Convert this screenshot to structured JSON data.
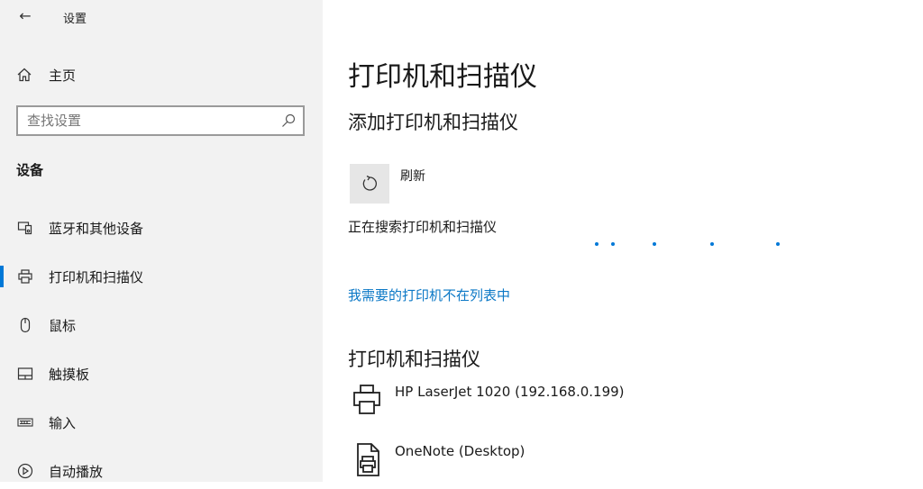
{
  "app": {
    "title": "设置"
  },
  "sidebar": {
    "home_label": "主页",
    "search_placeholder": "查找设置",
    "section": "设备",
    "items": [
      {
        "label": "蓝牙和其他设备",
        "icon": "bluetooth-devices-icon",
        "active": false
      },
      {
        "label": "打印机和扫描仪",
        "icon": "printer-icon",
        "active": true
      },
      {
        "label": "鼠标",
        "icon": "mouse-icon",
        "active": false
      },
      {
        "label": "触摸板",
        "icon": "touchpad-icon",
        "active": false
      },
      {
        "label": "输入",
        "icon": "keyboard-icon",
        "active": false
      },
      {
        "label": "自动播放",
        "icon": "autoplay-icon",
        "active": false
      }
    ]
  },
  "main": {
    "title": "打印机和扫描仪",
    "add_heading": "添加打印机和扫描仪",
    "refresh_label": "刷新",
    "status": "正在搜索打印机和扫描仪",
    "missing_printer_link": "我需要的打印机不在列表中",
    "list_heading": "打印机和扫描仪",
    "devices": [
      {
        "name": "HP LaserJet 1020 (192.168.0.199)",
        "icon": "printer-icon"
      },
      {
        "name": "OneNote (Desktop)",
        "icon": "document-printer-icon"
      }
    ]
  },
  "colors": {
    "accent": "#0078d7",
    "link": "#0b78c6",
    "sidebar_bg": "#f2f2f2"
  }
}
